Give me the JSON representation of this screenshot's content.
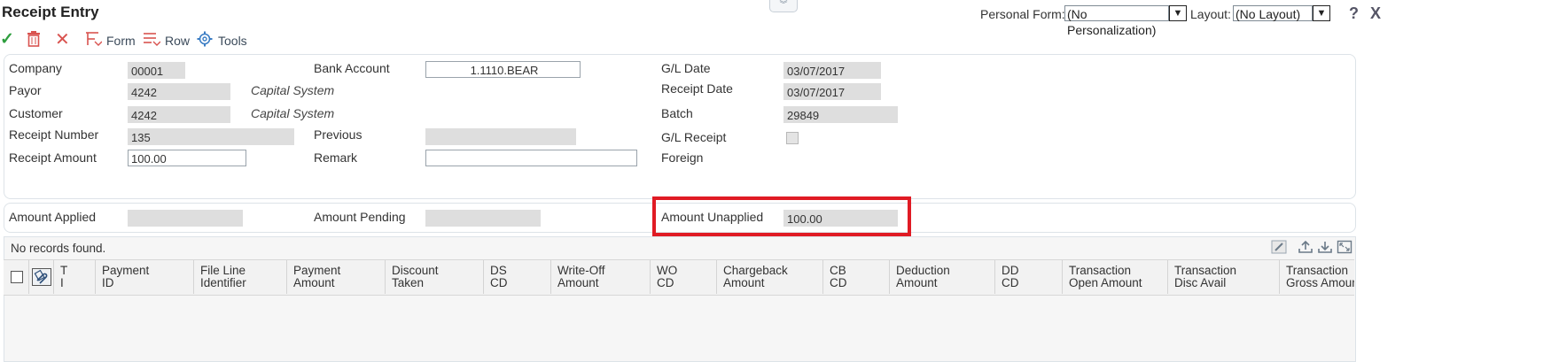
{
  "header": {
    "title": "Receipt Entry",
    "collapse_glyph": "︾",
    "personal_form_label": "Personal Form:",
    "personal_form_value": "(No Personalization)",
    "layout_label": "Layout:",
    "layout_value": "(No Layout)",
    "help_glyph": "?",
    "close_glyph": "X"
  },
  "toolbar": {
    "ok_glyph": "✓",
    "delete_glyph": "🗑",
    "cancel_glyph": "✕",
    "form_label": "Form",
    "row_label": "Row",
    "tools_label": "Tools"
  },
  "form": {
    "company_label": "Company",
    "company_value": "00001",
    "payor_label": "Payor",
    "payor_value": "4242",
    "payor_name": "Capital System",
    "customer_label": "Customer",
    "customer_value": "4242",
    "customer_name": "Capital System",
    "receipt_number_label": "Receipt Number",
    "receipt_number_value": "135",
    "receipt_amount_label": "Receipt Amount",
    "receipt_amount_value": "100.00",
    "bank_account_label": "Bank Account",
    "bank_account_value": "1.1110.BEAR",
    "previous_label": "Previous",
    "previous_value": "",
    "remark_label": "Remark",
    "remark_value": "",
    "gl_date_label": "G/L Date",
    "gl_date_value": "03/07/2017",
    "receipt_date_label": "Receipt Date",
    "receipt_date_value": "03/07/2017",
    "batch_label": "Batch",
    "batch_value": "29849",
    "gl_receipt_label": "G/L Receipt",
    "gl_receipt_checked": false,
    "foreign_label": "Foreign"
  },
  "totals": {
    "amount_applied_label": "Amount Applied",
    "amount_applied_value": "",
    "amount_pending_label": "Amount Pending",
    "amount_pending_value": "",
    "amount_unapplied_label": "Amount Unapplied",
    "amount_unapplied_value": "100.00"
  },
  "grid": {
    "status": "No records found.",
    "columns": [
      "T\nI",
      "Payment\nID",
      "File Line\nIdentifier",
      "Payment\nAmount",
      "Discount\nTaken",
      "DS\nCD",
      "Write-Off\nAmount",
      "WO\nCD",
      "Chargeback\nAmount",
      "CB\nCD",
      "Deduction\nAmount",
      "DD\nCD",
      "Transaction\nOpen Amount",
      "Transaction\nDisc Avail",
      "Transaction\nGross Amount"
    ],
    "rows": []
  },
  "colors": {
    "highlight": "#e01b24",
    "readonly_field": "#dedede",
    "ok_icon": "#2e9e3e",
    "delete_icon": "#d9534f"
  }
}
